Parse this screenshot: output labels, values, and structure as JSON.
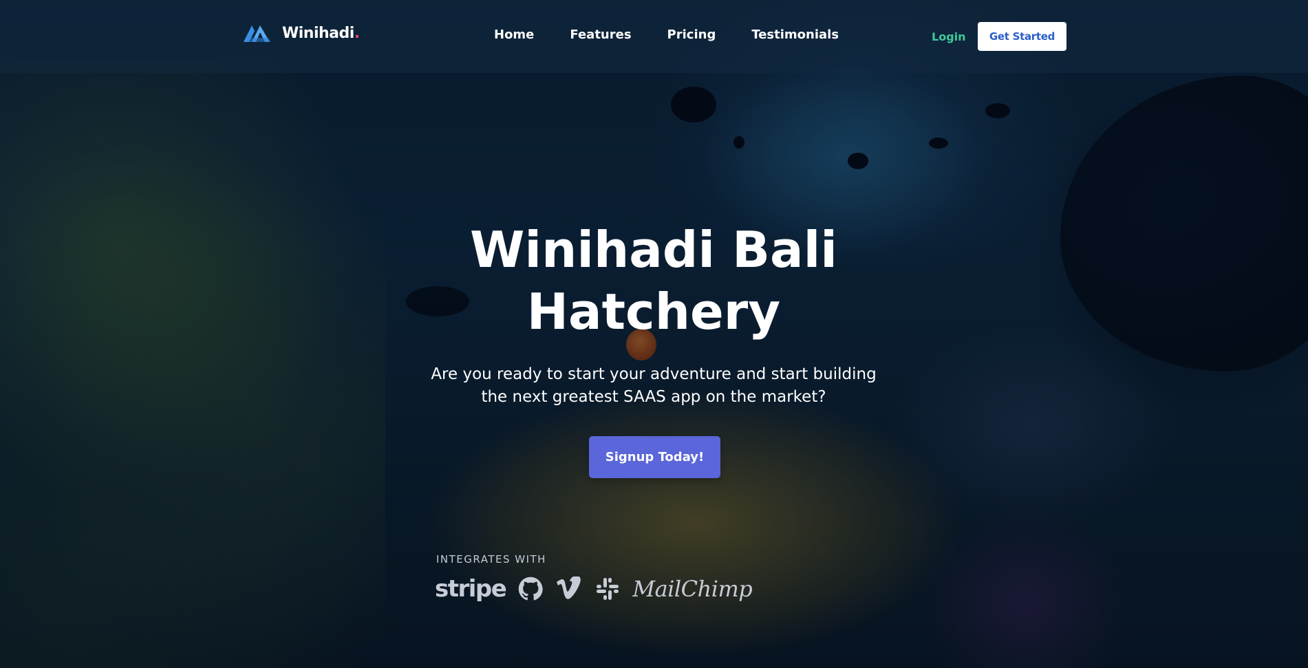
{
  "header": {
    "logo_text": "Winihadi",
    "logo_dot": ".",
    "nav": [
      {
        "label": "Home"
      },
      {
        "label": "Features"
      },
      {
        "label": "Pricing"
      },
      {
        "label": "Testimonials"
      }
    ],
    "login_label": "Login",
    "get_started_label": "Get Started"
  },
  "hero": {
    "title_line1": "Winihadi Bali",
    "title_line2": "Hatchery",
    "subtitle_line1": "Are you ready to start your adventure and start building",
    "subtitle_line2": "the next greatest SAAS app on the market?",
    "cta_label": "Signup Today!"
  },
  "integrations": {
    "label": "INTEGRATES WITH",
    "brands": [
      {
        "name": "stripe",
        "icon": "stripe-logo"
      },
      {
        "name": "",
        "icon": "github-icon"
      },
      {
        "name": "",
        "icon": "vimeo-icon"
      },
      {
        "name": "",
        "icon": "slack-icon"
      },
      {
        "name": "MailChimp",
        "icon": "mailchimp-logo"
      }
    ]
  },
  "colors": {
    "accent": "#5a66d9",
    "login": "#41c99a",
    "logo_dot": "#e6457a",
    "get_started_text": "#2b5fc8",
    "logo_mark": "#3a8ee6"
  }
}
